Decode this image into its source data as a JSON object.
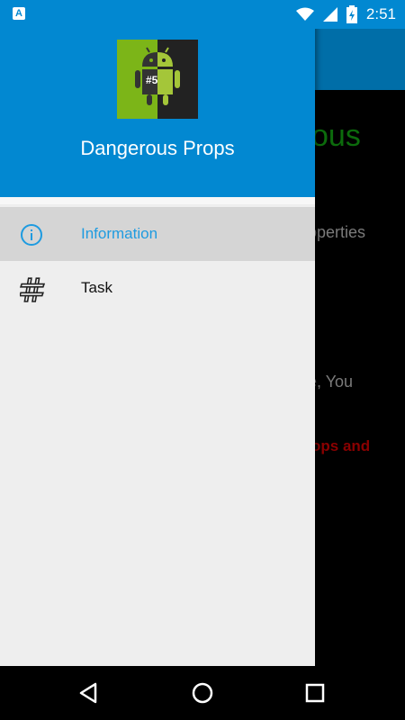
{
  "status_bar": {
    "time": "2:51",
    "left_badge": "A",
    "icons": [
      "wifi-icon",
      "signal-icon",
      "battery-icon"
    ]
  },
  "background_screen": {
    "title_fragment": "ous",
    "line1_fragment": "operties",
    "line2_fragment": "e, You",
    "line3_fragment": "ops and"
  },
  "drawer": {
    "title": "Dangerous Props",
    "logo_text": "#5",
    "items": [
      {
        "label": "Information",
        "icon": "info-icon",
        "selected": true
      },
      {
        "label": "Task",
        "icon": "hash-icon",
        "selected": false
      }
    ]
  },
  "nav_bar": {
    "buttons": [
      "back-button",
      "home-button",
      "recents-button"
    ]
  },
  "colors": {
    "primary": "#0288d1",
    "primary_dark": "#006ea8",
    "accent": "#1e9be0",
    "selected_bg": "#d5d5d5"
  }
}
